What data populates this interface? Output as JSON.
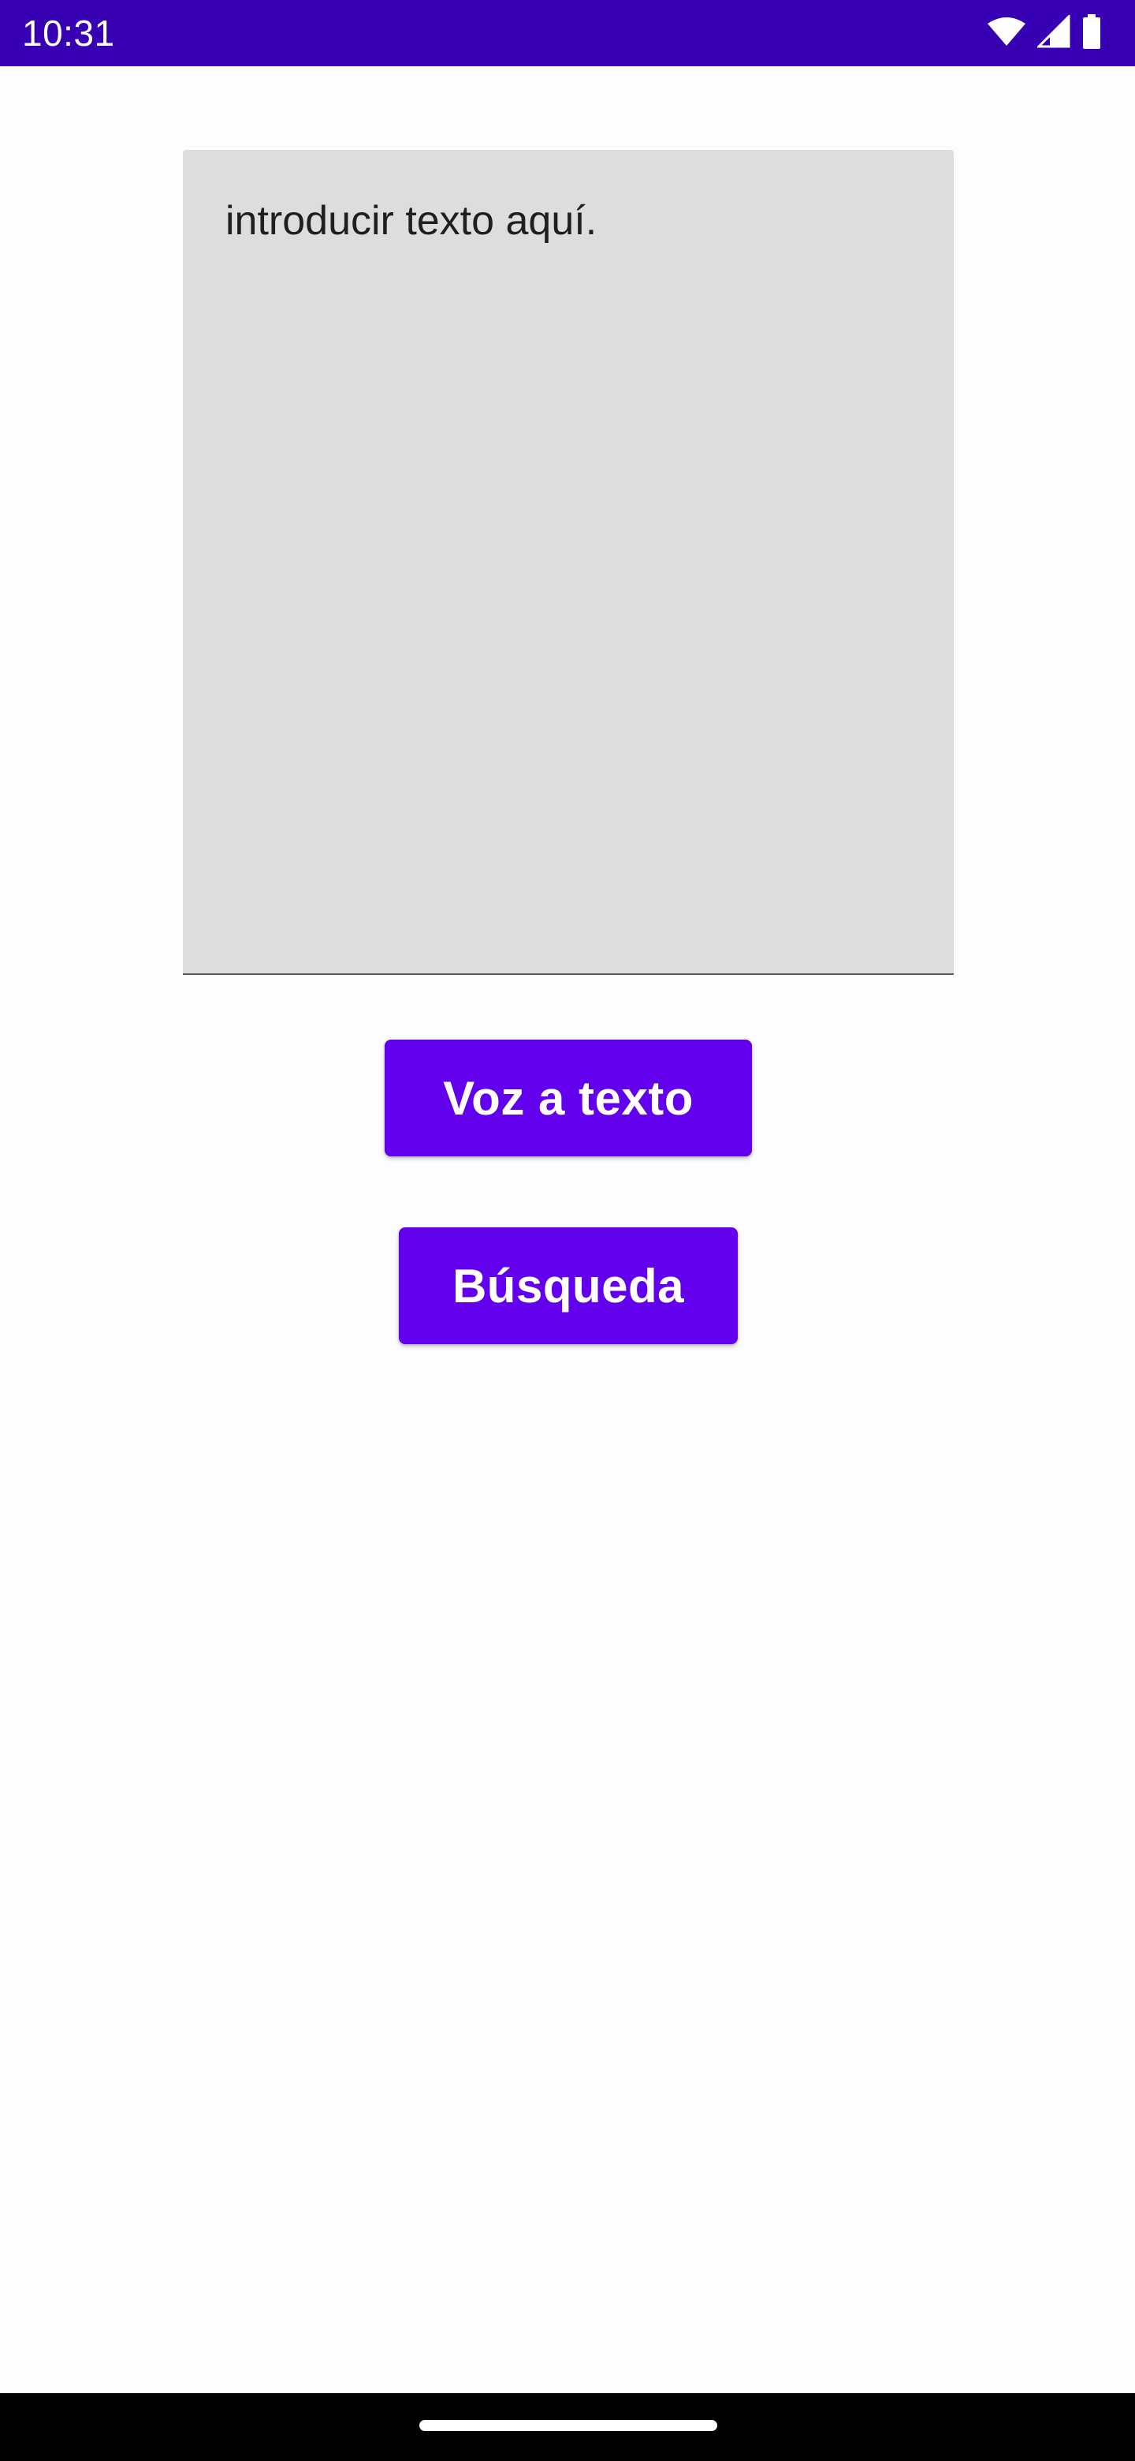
{
  "status_bar": {
    "time": "10:31",
    "background": "#3700B3",
    "icons": [
      "wifi-icon",
      "signal-icon",
      "battery-icon"
    ]
  },
  "text_area": {
    "placeholder": "introducir texto aquí.",
    "background": "#DDDDDD"
  },
  "buttons": {
    "voice_to_text": "Voz a texto",
    "search": "Búsqueda",
    "color": "#6200EE"
  },
  "nav_bar": {
    "background": "#000000",
    "icons": [
      "home-handle-icon"
    ]
  }
}
